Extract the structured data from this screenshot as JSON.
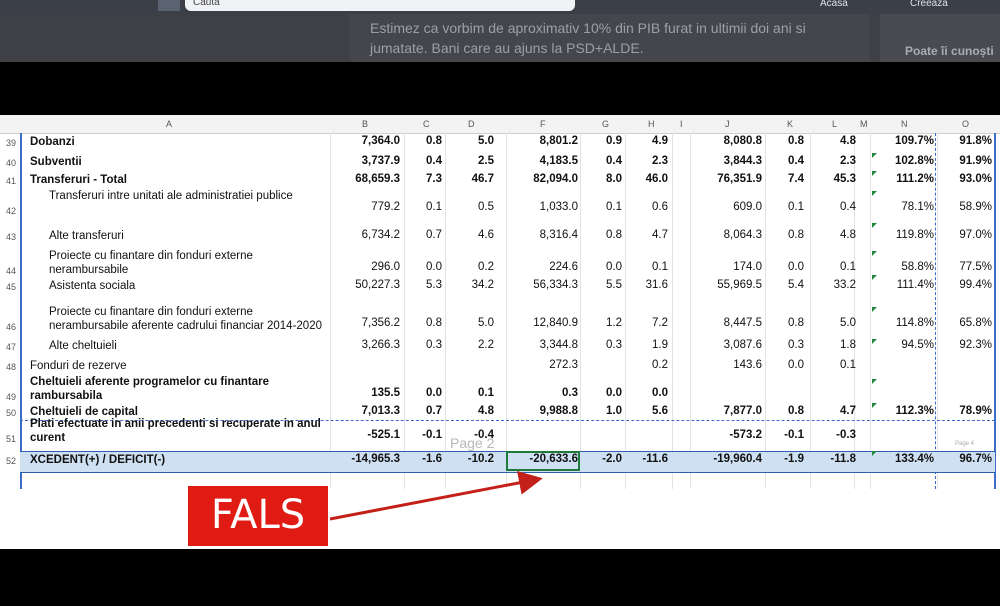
{
  "fb": {
    "search_placeholder": "Caută",
    "nav_items": [
      "Acasă",
      "Creează"
    ],
    "post_text": "Estimez ca vorbim de aproximativ 10% din PIB furat in ultimii doi ani si jumatate. Bani care au ajuns la PSD+ALDE.",
    "side_text": "Poate îi cunoști"
  },
  "sheet": {
    "columns": [
      "A",
      "B",
      "C",
      "D",
      "F",
      "G",
      "H",
      "I",
      "J",
      "K",
      "L",
      "M",
      "N",
      "O"
    ],
    "rows": [
      {
        "num": "39",
        "label": "Dobanzi",
        "bold": true,
        "indent": false,
        "vals": [
          "7,364.0",
          "0.8",
          "5.0",
          "8,801.2",
          "0.9",
          "4.9",
          "8,080.8",
          "0.8",
          "4.8",
          "109.7%",
          "91.8%"
        ]
      },
      {
        "num": "40",
        "label": "Subventii",
        "bold": true,
        "indent": false,
        "vals": [
          "3,737.9",
          "0.4",
          "2.5",
          "4,183.5",
          "0.4",
          "2.3",
          "3,844.3",
          "0.4",
          "2.3",
          "102.8%",
          "91.9%"
        ]
      },
      {
        "num": "41",
        "label": "Transferuri - Total",
        "bold": true,
        "indent": false,
        "vals": [
          "68,659.3",
          "7.3",
          "46.7",
          "82,094.0",
          "8.0",
          "46.0",
          "76,351.9",
          "7.4",
          "45.3",
          "111.2%",
          "93.0%"
        ]
      },
      {
        "num": "42",
        "label": "Transferuri intre unitati ale administratiei publice",
        "bold": false,
        "indent": true,
        "vals": [
          "779.2",
          "0.1",
          "0.5",
          "1,033.0",
          "0.1",
          "0.6",
          "609.0",
          "0.1",
          "0.4",
          "78.1%",
          "58.9%"
        ]
      },
      {
        "num": "43",
        "label": "Alte transferuri",
        "bold": false,
        "indent": true,
        "vals": [
          "6,734.2",
          "0.7",
          "4.6",
          "8,316.4",
          "0.8",
          "4.7",
          "8,064.3",
          "0.8",
          "4.8",
          "119.8%",
          "97.0%"
        ]
      },
      {
        "num": "44",
        "label": "Proiecte cu finantare din fonduri          externe nerambursabile",
        "bold": false,
        "indent": true,
        "vals": [
          "296.0",
          "0.0",
          "0.2",
          "224.6",
          "0.0",
          "0.1",
          "174.0",
          "0.0",
          "0.1",
          "58.8%",
          "77.5%"
        ]
      },
      {
        "num": "45",
        "label": "Asistenta sociala",
        "bold": false,
        "indent": true,
        "vals": [
          "50,227.3",
          "5.3",
          "34.2",
          "56,334.3",
          "5.5",
          "31.6",
          "55,969.5",
          "5.4",
          "33.2",
          "111.4%",
          "99.4%"
        ]
      },
      {
        "num": "46",
        "label": "Proiecte cu finantare din fonduri externe nerambursabile aferente cadrului financiar 2014-2020",
        "bold": false,
        "indent": true,
        "vals": [
          "7,356.2",
          "0.8",
          "5.0",
          "12,840.9",
          "1.2",
          "7.2",
          "8,447.5",
          "0.8",
          "5.0",
          "114.8%",
          "65.8%"
        ]
      },
      {
        "num": "47",
        "label": "Alte cheltuieli",
        "bold": false,
        "indent": true,
        "vals": [
          "3,266.3",
          "0.3",
          "2.2",
          "3,344.8",
          "0.3",
          "1.9",
          "3,087.6",
          "0.3",
          "1.8",
          "94.5%",
          "92.3%"
        ]
      },
      {
        "num": "48",
        "label": "Fonduri de rezerve",
        "bold": false,
        "indent": false,
        "vals": [
          "",
          "",
          "",
          "272.3",
          "",
          "0.2",
          "143.6",
          "0.0",
          "0.1",
          "",
          ""
        ]
      },
      {
        "num": "49",
        "label": "Cheltuieli aferente programelor cu finantare rambursabila",
        "bold": true,
        "indent": false,
        "vals": [
          "135.5",
          "0.0",
          "0.1",
          "0.3",
          "0.0",
          "0.0",
          "",
          "",
          "",
          "",
          ""
        ]
      },
      {
        "num": "50",
        "label": "Cheltuieli de capital",
        "bold": true,
        "indent": false,
        "vals": [
          "7,013.3",
          "0.7",
          "4.8",
          "9,988.8",
          "1.0",
          "5.6",
          "7,877.0",
          "0.8",
          "4.7",
          "112.3%",
          "78.9%"
        ]
      },
      {
        "num": "51",
        "label": "Plati efectuate in anii precedenti si recuperate in anul curent",
        "bold": true,
        "indent": false,
        "vals": [
          "-525.1",
          "-0.1",
          "-0.4",
          "",
          "",
          "",
          "-573.2",
          "-0.1",
          "-0.3",
          "",
          ""
        ]
      },
      {
        "num": "52",
        "label": "XCEDENT(+) / DEFICIT(-)",
        "bold": true,
        "indent": false,
        "vals": [
          "-14,965.3",
          "-1.6",
          "-10.2",
          "-20,633.6",
          "-2.0",
          "-11.6",
          "-19,960.4",
          "-1.9",
          "-11.8",
          "133.4%",
          "96.7%"
        ]
      }
    ],
    "watermark": "Page 2",
    "watermark_small": "Page 4"
  },
  "stamp": {
    "label": "FALS",
    "color": "#e01b14"
  }
}
